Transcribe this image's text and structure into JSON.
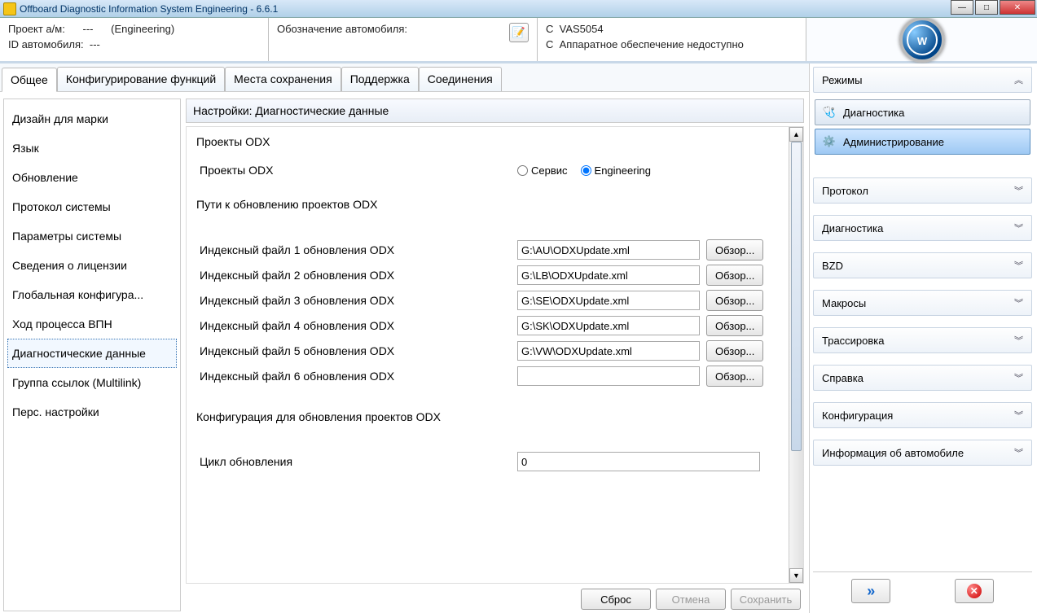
{
  "window": {
    "title": "Offboard Diagnostic Information System Engineering - 6.6.1"
  },
  "topinfo": {
    "project_label": "Проект а/м:",
    "project_value": "---",
    "project_suffix": "(Engineering)",
    "id_label": "ID автомобиля:",
    "id_value": "---",
    "vehicle_designation_label": "Обозначение автомобиля:",
    "status1_prefix": "С",
    "status1": "VAS5054",
    "status2_prefix": "С",
    "status2": "Аппаратное обеспечение недоступно"
  },
  "tabs": [
    "Общее",
    "Конфигурирование функций",
    "Места сохранения",
    "Поддержка",
    "Соединения"
  ],
  "active_tab": 0,
  "side_items": [
    "Дизайн для марки",
    "Язык",
    "Обновление",
    "Протокол системы",
    "Параметры системы",
    "Сведения о лицензии",
    "Глобальная конфигура...",
    "Ход процесса ВПН",
    "Диагностические данные",
    "Группа ссылок (Multilink)",
    "Перс. настройки"
  ],
  "side_selected": 8,
  "settings": {
    "title": "Настройки: Диагностические данные",
    "section_projects": "Проекты ODX",
    "projects_label": "Проекты ODX",
    "radio_service": "Сервис",
    "radio_engineering": "Engineering",
    "radio_selected": "engineering",
    "section_paths": "Пути к обновлению проектов ODX",
    "index_files": [
      {
        "label": "Индексный файл 1 обновления ODX",
        "value": "G:\\AU\\ODXUpdate.xml"
      },
      {
        "label": "Индексный файл 2 обновления ODX",
        "value": "G:\\LB\\ODXUpdate.xml"
      },
      {
        "label": "Индексный файл 3 обновления ODX",
        "value": "G:\\SE\\ODXUpdate.xml"
      },
      {
        "label": "Индексный файл 4 обновления ODX",
        "value": "G:\\SK\\ODXUpdate.xml"
      },
      {
        "label": "Индексный файл 5 обновления ODX",
        "value": "G:\\VW\\ODXUpdate.xml"
      },
      {
        "label": "Индексный файл 6 обновления ODX",
        "value": ""
      }
    ],
    "browse": "Обзор...",
    "section_config": "Конфигурация для обновления проектов ODX",
    "cycle_label": "Цикл обновления",
    "cycle_value": "0",
    "btn_reset": "Сброс",
    "btn_cancel": "Отмена",
    "btn_save": "Сохранить"
  },
  "right": {
    "modes_title": "Режимы",
    "mode_diag": "Диагностика",
    "mode_admin": "Администрирование",
    "sections": [
      "Протокол",
      "Диагностика",
      "BZD",
      "Макросы",
      "Трассировка",
      "Справка",
      "Конфигурация",
      "Информация об автомобиле"
    ]
  }
}
